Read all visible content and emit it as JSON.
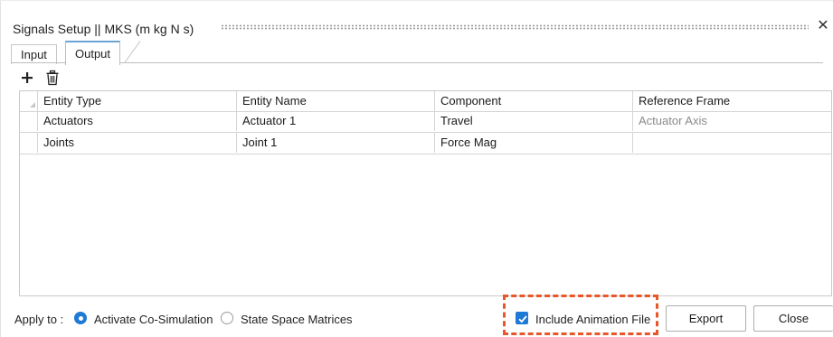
{
  "window": {
    "title": "Signals Setup || MKS (m kg N s)",
    "close_glyph": "✕"
  },
  "tabs": [
    {
      "label": "Input",
      "active": false
    },
    {
      "label": "Output",
      "active": true
    }
  ],
  "toolbar": {
    "add_icon": "plus-icon",
    "delete_icon": "trash-icon"
  },
  "table": {
    "columns": [
      "Entity Type",
      "Entity Name",
      "Component",
      "Reference Frame"
    ],
    "rows": [
      [
        "Actuators",
        "Actuator 1",
        "Travel",
        "Actuator Axis"
      ],
      [
        "Joints",
        "Joint 1",
        "Force Mag",
        ""
      ]
    ]
  },
  "footer": {
    "apply_label": "Apply to :",
    "options": [
      {
        "label": "Activate Co-Simulation",
        "selected": true
      },
      {
        "label": "State Space Matrices",
        "selected": false
      }
    ],
    "include_animation": {
      "label": "Include Animation File",
      "checked": true
    },
    "export_label": "Export",
    "close_label": "Close"
  },
  "colors": {
    "accent": "#1f7ad6",
    "highlight": "#e8572a"
  }
}
